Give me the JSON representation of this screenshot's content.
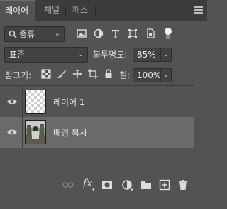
{
  "tabs": [
    {
      "label": "레이어"
    },
    {
      "label": "채널"
    },
    {
      "label": "패스"
    }
  ],
  "filter": {
    "kind_label": "종류",
    "icons": [
      "image-filter-icon",
      "adjustment-filter-icon",
      "type-filter-icon",
      "shape-filter-icon",
      "smart-object-filter-icon",
      "filter-toggle-icon"
    ]
  },
  "blend": {
    "mode": "표준",
    "opacity_label": "불투명도:",
    "opacity_value": "85%"
  },
  "lock": {
    "label": "잠그기:",
    "icons": [
      "lock-transparent-icon",
      "lock-paint-icon",
      "lock-move-icon",
      "lock-artboard-icon",
      "lock-all-icon"
    ],
    "fill_label": "칠:",
    "fill_value": "100%"
  },
  "layers": [
    {
      "name": "레이어 1",
      "visible": true,
      "selected": false,
      "thumb": "transparent"
    },
    {
      "name": "배경 복사",
      "visible": true,
      "selected": true,
      "thumb": "photo"
    }
  ],
  "bottom_toolbar": {
    "icons": [
      "link-layers-icon",
      "fx-icon",
      "add-mask-icon",
      "new-adjustment-icon",
      "new-group-icon",
      "new-layer-icon",
      "delete-layer-icon"
    ],
    "fx_label": "fx"
  }
}
